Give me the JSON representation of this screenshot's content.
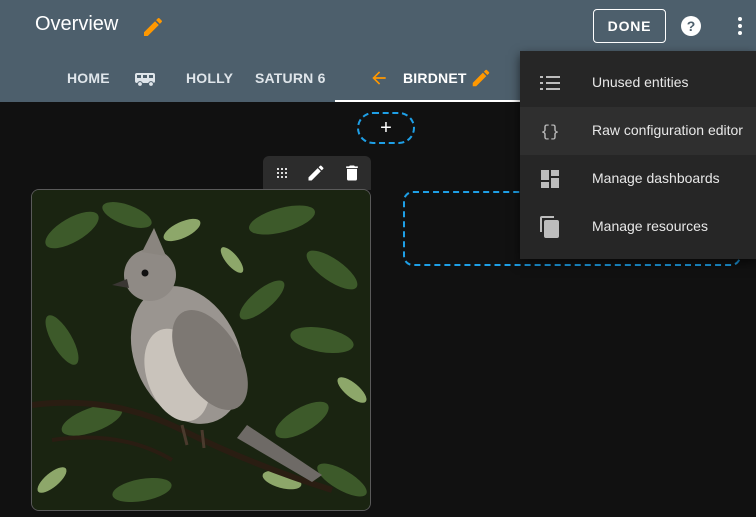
{
  "header": {
    "title": "Overview",
    "done_label": "DONE",
    "tabs": [
      {
        "label": "HOME"
      },
      {
        "label": "HOLLY"
      },
      {
        "label": "SATURN 6"
      },
      {
        "label": "BIRDNET",
        "active": true
      }
    ],
    "accent_color": "#ff9800",
    "bar_color": "#4d5f6c"
  },
  "main": {
    "add_badge": "+",
    "drop_outline_color": "#1e9fe6"
  },
  "menu": {
    "items": [
      {
        "label": "Unused entities",
        "icon": "list-icon"
      },
      {
        "label": "Raw configuration editor",
        "icon": "code-braces-icon"
      },
      {
        "label": "Manage dashboards",
        "icon": "dashboard-icon"
      },
      {
        "label": "Manage resources",
        "icon": "file-document-icon"
      }
    ]
  }
}
